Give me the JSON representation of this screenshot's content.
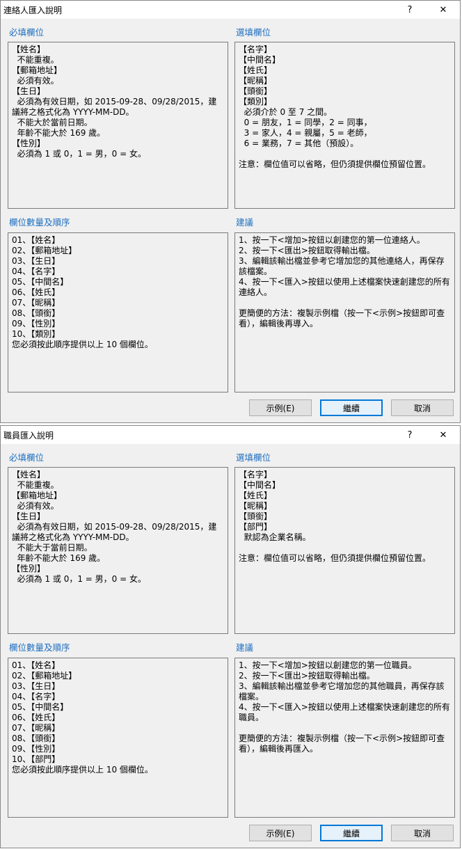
{
  "dialogs": [
    {
      "title": "連絡人匯入說明",
      "help_label": "?",
      "close_label": "✕",
      "required": {
        "heading": "必填欄位",
        "text": "【姓名】\n  不能重複。\n【郵箱地址】\n  必須有效。\n【生日】\n  必須為有效日期，如 2015-09-28、09/28/2015，建議將之格式化為 YYYY-MM-DD。\n  不能大於當前日期。\n  年齡不能大於 169 歲。\n【性別】\n  必須為 1 或 0，1 = 男，0 = 女。"
      },
      "optional": {
        "heading": "選填欄位",
        "text": "【名字】\n【中間名】\n【姓氏】\n【昵稱】\n【頭銜】\n【類別】\n  必須介於 0 至 7 之間。\n  0 = 朋友，1 = 同學，2 = 同事，\n  3 = 家人，4 = 親屬，5 = 老師，\n  6 = 業務，7 = 其他（預設）。\n\n注意：欄位值可以省略，但仍須提供欄位預留位置。"
      },
      "order": {
        "heading": "欄位數量及順序",
        "text": "01、【姓名】\n02、【郵箱地址】\n03、【生日】\n04、【名字】\n05、【中間名】\n06、【姓氏】\n07、【昵稱】\n08、【頭銜】\n09、【性別】\n10、【類別】\n您必須按此順序提供以上 10 個欄位。"
      },
      "advice": {
        "heading": "建議",
        "text": "1、按一下<增加>按鈕以創建您的第一位連絡人。\n2、按一下<匯出>按鈕取得輸出檔。\n3、編輯該輸出檔並參考它增加您的其他連絡人，再保存該檔案。\n4、按一下<匯入>按鈕以使用上述檔案快速創建您的所有連絡人。\n\n更簡便的方法：複製示例檔（按一下<示例>按鈕即可查看），編輯後再導入。"
      },
      "buttons": {
        "example": "示例(E)",
        "continue": "繼續",
        "cancel": "取消"
      }
    },
    {
      "title": "職員匯入說明",
      "help_label": "?",
      "close_label": "✕",
      "required": {
        "heading": "必填欄位",
        "text": "【姓名】\n  不能重複。\n【郵箱地址】\n  必須有效。\n【生日】\n  必須為有效日期，如 2015-09-28、09/28/2015，建議將之格式化為 YYYY-MM-DD。\n  不能大于當前日期。\n  年齡不能大於 169 歲。\n【性別】\n  必須為 1 或 0，1 = 男，0 = 女。"
      },
      "optional": {
        "heading": "選填欄位",
        "text": "【名字】\n【中間名】\n【姓氏】\n【昵稱】\n【頭銜】\n【部門】\n  默認為企業名稱。\n\n注意：欄位值可以省略，但仍須提供欄位預留位置。"
      },
      "order": {
        "heading": "欄位數量及順序",
        "text": "01、【姓名】\n02、【郵箱地址】\n03、【生日】\n04、【名字】\n05、【中間名】\n06、【姓氏】\n07、【昵稱】\n08、【頭銜】\n09、【性別】\n10、【部門】\n您必須按此順序提供以上 10 個欄位。"
      },
      "advice": {
        "heading": "建議",
        "text": "1、按一下<增加>按鈕以創建您的第一位職員。\n2、按一下<匯出>按鈕取得輸出檔。\n3、編輯該輸出檔並參考它增加您的其他職員，再保存該檔案。\n4、按一下<匯入>按鈕以使用上述檔案快速創建您的所有職員。\n\n更簡便的方法：複製示例檔（按一下<示例>按鈕即可查看），編輯後再匯入。"
      },
      "buttons": {
        "example": "示例(E)",
        "continue": "繼續",
        "cancel": "取消"
      }
    }
  ]
}
